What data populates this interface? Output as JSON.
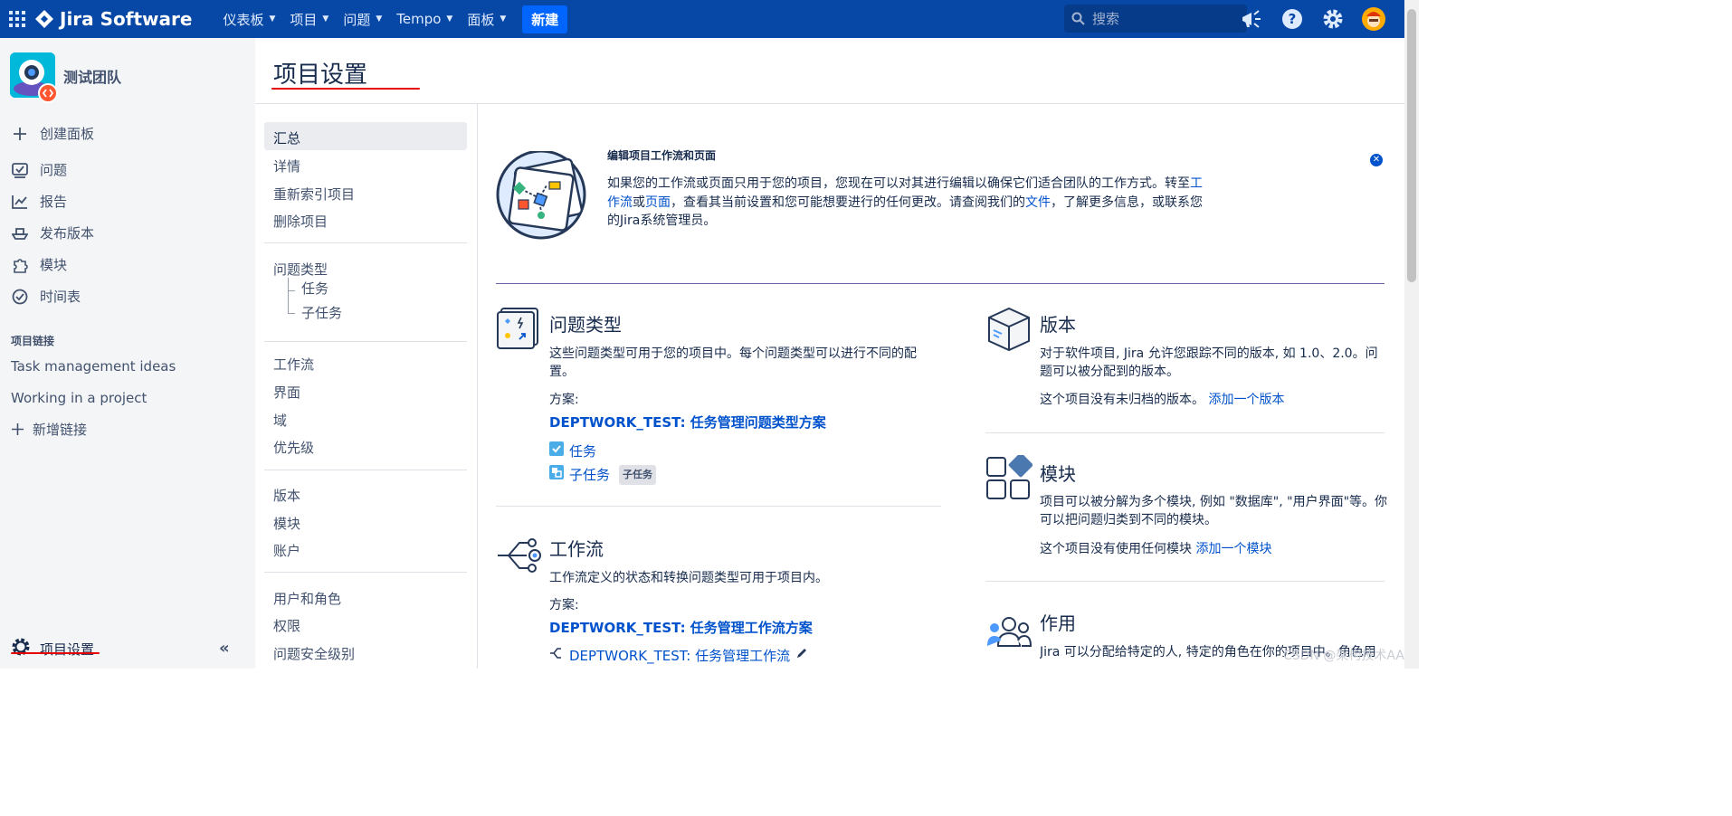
{
  "topbar": {
    "product_name": "Jira Software",
    "nav": [
      "仪表板",
      "项目",
      "问题",
      "Tempo",
      "面板"
    ],
    "create_label": "新建",
    "search_placeholder": "搜索"
  },
  "sidebar": {
    "project_name": "测试团队",
    "items": [
      "创建面板",
      "问题",
      "报告",
      "发布版本",
      "模块",
      "时间表"
    ],
    "section_title": "项目链接",
    "links": [
      "Task management ideas",
      "Working in a project"
    ],
    "add_link_label": "新增链接",
    "settings_label": "项目设置",
    "collapse_icon": "«"
  },
  "page": {
    "title": "项目设置"
  },
  "settings_nav": {
    "group1": [
      "汇总",
      "详情",
      "重新索引项目",
      "删除项目"
    ],
    "issue_types_label": "问题类型",
    "issue_types_children": [
      "任务",
      "子任务"
    ],
    "group3": [
      "工作流",
      "界面",
      "域",
      "优先级"
    ],
    "group4": [
      "版本",
      "模块",
      "账户"
    ],
    "group5": [
      "用户和角色",
      "权限",
      "问题安全级别"
    ]
  },
  "banner": {
    "title": "编辑项目工作流和页面",
    "text_1": "如果您的工作流或页面只用于您的项目，您现在可以对其进行编辑以确保它们适合团队的工作方式。转至",
    "link_workflow": "工作流",
    "text_or": "或",
    "link_screen": "页面",
    "text_2": "，查看其当前设置和您可能想要进行的任何更改。请查阅我们的",
    "link_docs": "文件",
    "text_3": "，了解更多信息，或联系您的Jira系统管理员。"
  },
  "issue_types": {
    "title": "问题类型",
    "description": "这些问题类型可用于您的项目中。每个问题类型可以进行不同的配置。",
    "scheme_label": "方案:",
    "scheme_name": "DEPTWORK_TEST: 任务管理问题类型方案",
    "types": [
      {
        "name": "任务",
        "badge": ""
      },
      {
        "name": "子任务",
        "badge": "子任务"
      }
    ]
  },
  "workflow": {
    "title": "工作流",
    "description": "工作流定义的状态和转换问题类型可用于项目内。",
    "scheme_label": "方案:",
    "scheme_name": "DEPTWORK_TEST: 任务管理工作流方案",
    "workflow_name": "DEPTWORK_TEST: 任务管理工作流"
  },
  "versions": {
    "title": "版本",
    "description": "对于软件项目, Jira 允许您跟踪不同的版本, 如 1.0、2.0。问题可以被分配到的版本。",
    "empty_text": "这个项目没有未归档的版本。",
    "add_link": "添加一个版本"
  },
  "components": {
    "title": "模块",
    "description": "项目可以被分解为多个模块, 例如 \"数据库\", \"用户界面\"等。你可以把问题归类到不同的模块。",
    "empty_text": "这个项目没有使用任何模块",
    "add_link": "添加一个模块"
  },
  "roles": {
    "title": "作用",
    "description": "Jira 可以分配给特定的人, 特定的角色在你的项目中。角色用"
  },
  "watermark": "CSDN @架构技术AA",
  "colors": {
    "header": "#0747a6",
    "create": "#0065ff",
    "link": "#0052cc",
    "annotation": "#e60000"
  }
}
